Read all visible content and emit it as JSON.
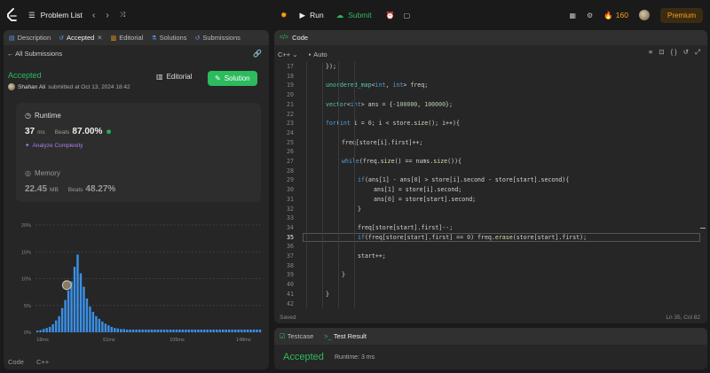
{
  "topbar": {
    "problem_list": "Problem List",
    "run": "Run",
    "submit": "Submit",
    "streak": "160",
    "premium": "Premium"
  },
  "left_tabs": [
    {
      "label": "Description",
      "icon": "document-icon"
    },
    {
      "label": "Accepted",
      "icon": "history-icon",
      "close": "✕"
    },
    {
      "label": "Editorial",
      "icon": "book-icon"
    },
    {
      "label": "Solutions",
      "icon": "flask-icon"
    },
    {
      "label": "Submissions",
      "icon": "history-icon"
    }
  ],
  "submission": {
    "back_label": "All Submissions",
    "status": "Accepted",
    "user": "Shahan Ali",
    "submitted_text": "submitted at Oct 13, 2024 18:42",
    "editorial_btn": "Editorial",
    "solution_btn": "Solution"
  },
  "runtime_stat": {
    "label": "Runtime",
    "value": "37",
    "unit": "ms",
    "beats_label": "Beats",
    "beats": "87.00%",
    "analyze": "Analyze Complexity"
  },
  "memory_stat": {
    "label": "Memory",
    "value": "22.45",
    "unit": "MB",
    "beats_label": "Beats",
    "beats": "48.27%"
  },
  "chart_data": {
    "type": "bar",
    "yticks": [
      "20%",
      "15%",
      "10%",
      "5%",
      "0%"
    ],
    "ylim": [
      0,
      20
    ],
    "xticks": [
      "18ms",
      "61ms",
      "105ms",
      "148ms"
    ],
    "x_range_ms": [
      18,
      165
    ],
    "bar_start_ms": 18,
    "bar_step_ms": 2,
    "highlight_value_ms": 37,
    "values": [
      0.3,
      0.4,
      0.6,
      0.8,
      1.0,
      1.5,
      2.2,
      3.0,
      4.5,
      6.0,
      7.8,
      9.5,
      12.2,
      14.5,
      11.0,
      8.5,
      6.3,
      4.8,
      3.8,
      3.0,
      2.5,
      2.0,
      1.6,
      1.3,
      1.0,
      0.8,
      0.7,
      0.6,
      0.6,
      0.5,
      0.5,
      0.5,
      0.5,
      0.5,
      0.5,
      0.5,
      0.5,
      0.5,
      0.5,
      0.5,
      0.5,
      0.5,
      0.5,
      0.5,
      0.5,
      0.5,
      0.5,
      0.5,
      0.5,
      0.5,
      0.5,
      0.5,
      0.5,
      0.5,
      0.5,
      0.5,
      0.5,
      0.5,
      0.5,
      0.5,
      0.5,
      0.5,
      0.5,
      0.5,
      0.5,
      0.5,
      0.5,
      0.5,
      0.5,
      0.5,
      0.5,
      0.5,
      0.5
    ],
    "grid": true,
    "colors": {
      "bar": "#3b8fe6",
      "grid": "#3e3e3e"
    }
  },
  "language_row": {
    "code_label": "Code",
    "lang": "C++"
  },
  "editor": {
    "tab": "Code",
    "lang": "C++",
    "auto": "Auto",
    "status": "Saved",
    "position": "Ln 35, Col 82",
    "current_line": 35,
    "lines": [
      {
        "n": "17",
        "indent": 1,
        "text": "});"
      },
      {
        "n": "18",
        "indent": 0,
        "text": ""
      },
      {
        "n": "19",
        "indent": 1,
        "text": "unordered_map<int, int> freq;"
      },
      {
        "n": "20",
        "indent": 0,
        "text": ""
      },
      {
        "n": "21",
        "indent": 1,
        "text": "vector<int> ans = {-100000, 100000};"
      },
      {
        "n": "22",
        "indent": 0,
        "text": ""
      },
      {
        "n": "23",
        "indent": 1,
        "text": "for(int i = 0; i < store.size(); i++){"
      },
      {
        "n": "24",
        "indent": 0,
        "text": ""
      },
      {
        "n": "25",
        "indent": 2,
        "text": "freq[store[i].first]++;"
      },
      {
        "n": "26",
        "indent": 0,
        "text": ""
      },
      {
        "n": "27",
        "indent": 2,
        "text": "while(freq.size() == nums.size()){"
      },
      {
        "n": "28",
        "indent": 0,
        "text": ""
      },
      {
        "n": "29",
        "indent": 3,
        "text": "if(ans[1] - ans[0] > store[i].second - store[start].second){"
      },
      {
        "n": "30",
        "indent": 4,
        "text": "ans[1] = store[i].second;"
      },
      {
        "n": "31",
        "indent": 4,
        "text": "ans[0] = store[start].second;"
      },
      {
        "n": "32",
        "indent": 3,
        "text": "}"
      },
      {
        "n": "33",
        "indent": 0,
        "text": ""
      },
      {
        "n": "34",
        "indent": 3,
        "text": "freq[store[start].first]--;"
      },
      {
        "n": "35",
        "indent": 3,
        "text": "if(freq[store[start].first] == 0) freq.erase(store[start].first);"
      },
      {
        "n": "36",
        "indent": 0,
        "text": ""
      },
      {
        "n": "37",
        "indent": 3,
        "text": "start++;"
      },
      {
        "n": "38",
        "indent": 0,
        "text": ""
      },
      {
        "n": "39",
        "indent": 2,
        "text": "}"
      },
      {
        "n": "40",
        "indent": 0,
        "text": ""
      },
      {
        "n": "41",
        "indent": 1,
        "text": "}"
      },
      {
        "n": "42",
        "indent": 0,
        "text": ""
      }
    ]
  },
  "bottom": {
    "testcase": "Testcase",
    "test_result": "Test Result",
    "result": "Accepted",
    "runtime": "Runtime: 3 ms"
  }
}
